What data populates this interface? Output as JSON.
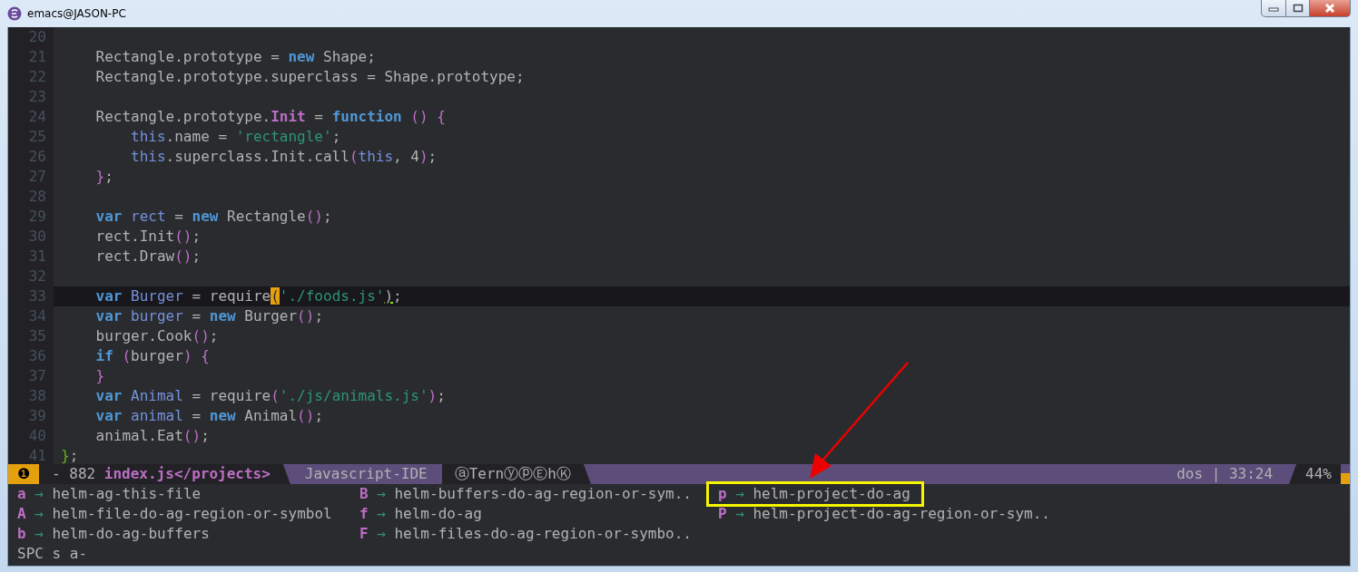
{
  "window": {
    "title": "emacs@JASON-PC"
  },
  "editor": {
    "lines": [
      {
        "number": "20",
        "current": false
      },
      {
        "number": "21",
        "current": false,
        "tokens": [
          {
            "kind": "plain",
            "text": "    Rectangle.prototype = "
          },
          {
            "kind": "keyword",
            "text": "new"
          },
          {
            "kind": "plain",
            "text": " Shape;"
          }
        ]
      },
      {
        "number": "22",
        "current": false,
        "tokens": [
          {
            "kind": "plain",
            "text": "    Rectangle.prototype.superclass = Shape.prototype;"
          }
        ]
      },
      {
        "number": "23",
        "current": false
      },
      {
        "number": "24",
        "current": false,
        "tokens": [
          {
            "kind": "plain",
            "text": "    Rectangle.prototype."
          },
          {
            "kind": "function",
            "text": "Init"
          },
          {
            "kind": "plain",
            "text": " = "
          },
          {
            "kind": "keyword",
            "text": "function "
          },
          {
            "kind": "paren",
            "text": "() {"
          }
        ]
      },
      {
        "number": "25",
        "current": false,
        "tokens": [
          {
            "kind": "variable",
            "text": "        this"
          },
          {
            "kind": "plain",
            "text": ".name = "
          },
          {
            "kind": "string",
            "text": "'rectangle'"
          },
          {
            "kind": "plain",
            "text": ";"
          }
        ]
      },
      {
        "number": "26",
        "current": false,
        "tokens": [
          {
            "kind": "variable",
            "text": "        this"
          },
          {
            "kind": "plain",
            "text": ".superclass.Init.call"
          },
          {
            "kind": "paren",
            "text": "("
          },
          {
            "kind": "variable",
            "text": "this"
          },
          {
            "kind": "plain",
            "text": ", 4"
          },
          {
            "kind": "paren",
            "text": ")"
          },
          {
            "kind": "plain",
            "text": ";"
          }
        ]
      },
      {
        "number": "27",
        "current": false,
        "tokens": [
          {
            "kind": "paren",
            "text": "    }"
          },
          {
            "kind": "plain",
            "text": ";"
          }
        ]
      },
      {
        "number": "28",
        "current": false
      },
      {
        "number": "29",
        "current": false,
        "tokens": [
          {
            "kind": "keyword",
            "text": "    var "
          },
          {
            "kind": "variable",
            "text": "rect"
          },
          {
            "kind": "plain",
            "text": " = "
          },
          {
            "kind": "keyword",
            "text": "new"
          },
          {
            "kind": "plain",
            "text": " Rectangle"
          },
          {
            "kind": "paren",
            "text": "()"
          },
          {
            "kind": "plain",
            "text": ";"
          }
        ]
      },
      {
        "number": "30",
        "current": false,
        "tokens": [
          {
            "kind": "plain",
            "text": "    rect.Init"
          },
          {
            "kind": "paren",
            "text": "()"
          },
          {
            "kind": "plain",
            "text": ";"
          }
        ]
      },
      {
        "number": "31",
        "current": false,
        "tokens": [
          {
            "kind": "plain",
            "text": "    rect.Draw"
          },
          {
            "kind": "paren",
            "text": "()"
          },
          {
            "kind": "plain",
            "text": ";"
          }
        ]
      },
      {
        "number": "32",
        "current": false
      },
      {
        "number": "33",
        "current": true,
        "tokens": [
          {
            "kind": "keyword",
            "text": "    var "
          },
          {
            "kind": "variable",
            "text": "Burger"
          },
          {
            "kind": "plain",
            "text": " = require"
          },
          {
            "kind": "cursor",
            "text": "("
          },
          {
            "kind": "string",
            "text": "'./foods.js'"
          },
          {
            "kind": "match",
            "text": ")"
          },
          {
            "kind": "plain",
            "text": ";"
          }
        ]
      },
      {
        "number": "34",
        "current": false,
        "tokens": [
          {
            "kind": "keyword",
            "text": "    var "
          },
          {
            "kind": "variable",
            "text": "burger"
          },
          {
            "kind": "plain",
            "text": " = "
          },
          {
            "kind": "keyword",
            "text": "new"
          },
          {
            "kind": "plain",
            "text": " Burger"
          },
          {
            "kind": "paren",
            "text": "()"
          },
          {
            "kind": "plain",
            "text": ";"
          }
        ]
      },
      {
        "number": "35",
        "current": false,
        "tokens": [
          {
            "kind": "plain",
            "text": "    burger.Cook"
          },
          {
            "kind": "paren",
            "text": "()"
          },
          {
            "kind": "plain",
            "text": ";"
          }
        ]
      },
      {
        "number": "36",
        "current": false,
        "tokens": [
          {
            "kind": "keyword",
            "text": "    if "
          },
          {
            "kind": "paren",
            "text": "("
          },
          {
            "kind": "plain",
            "text": "burger"
          },
          {
            "kind": "paren",
            "text": ") {"
          }
        ]
      },
      {
        "number": "37",
        "current": false,
        "tokens": [
          {
            "kind": "paren",
            "text": "    }"
          }
        ]
      },
      {
        "number": "38",
        "current": false,
        "tokens": [
          {
            "kind": "keyword",
            "text": "    var "
          },
          {
            "kind": "variable",
            "text": "Animal"
          },
          {
            "kind": "plain",
            "text": " = require"
          },
          {
            "kind": "paren",
            "text": "("
          },
          {
            "kind": "string",
            "text": "'./js/animals.js'"
          },
          {
            "kind": "paren",
            "text": ")"
          },
          {
            "kind": "plain",
            "text": ";"
          }
        ]
      },
      {
        "number": "39",
        "current": false,
        "tokens": [
          {
            "kind": "keyword",
            "text": "    var "
          },
          {
            "kind": "variable",
            "text": "animal"
          },
          {
            "kind": "plain",
            "text": " = "
          },
          {
            "kind": "keyword",
            "text": "new"
          },
          {
            "kind": "plain",
            "text": " Animal"
          },
          {
            "kind": "paren",
            "text": "()"
          },
          {
            "kind": "plain",
            "text": ";"
          }
        ]
      },
      {
        "number": "40",
        "current": false,
        "tokens": [
          {
            "kind": "plain",
            "text": "    animal.Eat"
          },
          {
            "kind": "paren",
            "text": "()"
          },
          {
            "kind": "plain",
            "text": ";"
          }
        ]
      },
      {
        "number": "41",
        "current": false,
        "tokens": [
          {
            "kind": "brace",
            "text": "}"
          },
          {
            "kind": "plain",
            "text": ";"
          }
        ]
      }
    ]
  },
  "mode_line": {
    "badge": "❶",
    "buffer_size": "- 882",
    "buffer_name": "index.js</projects>",
    "major_mode": "Javascript-IDE",
    "minor_modes": "ⓐTernⓨⓟⒺhⓀ",
    "status": "dos | 33:24",
    "percent": "44%"
  },
  "which_key": {
    "columns": [
      [
        {
          "key": "a",
          "arrow": "→",
          "command": "helm-ag-this-file",
          "annotated": false
        },
        {
          "key": "A",
          "arrow": "→",
          "command": "helm-file-do-ag-region-or-symbol",
          "annotated": false
        },
        {
          "key": "b",
          "arrow": "→",
          "command": "helm-do-ag-buffers",
          "annotated": false
        }
      ],
      [
        {
          "key": "B",
          "arrow": "→",
          "command": "helm-buffers-do-ag-region-or-sym..",
          "annotated": false
        },
        {
          "key": "f",
          "arrow": "→",
          "command": "helm-do-ag",
          "annotated": false
        },
        {
          "key": "F",
          "arrow": "→",
          "command": "helm-files-do-ag-region-or-symbo..",
          "annotated": false
        }
      ],
      [
        {
          "key": "p",
          "arrow": "→",
          "command": "helm-project-do-ag",
          "annotated": true
        },
        {
          "key": "P",
          "arrow": "→",
          "command": "helm-project-do-ag-region-or-sym..",
          "annotated": false
        }
      ]
    ]
  },
  "echo_area": {
    "text": "SPC s a-"
  }
}
